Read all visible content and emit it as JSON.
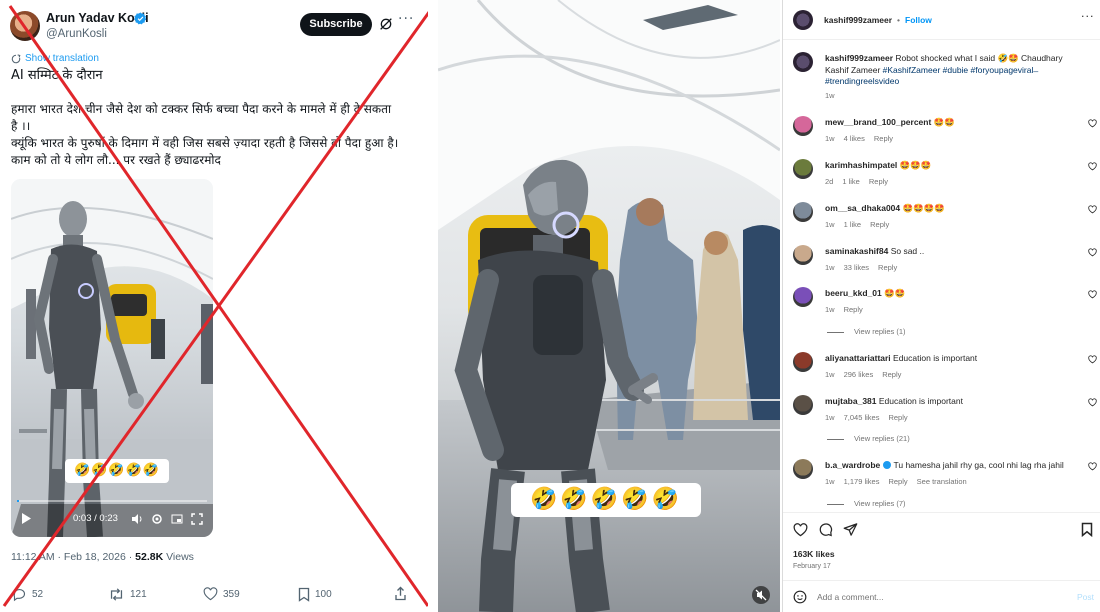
{
  "twitter": {
    "author_name": "Arun Yadav Kosli",
    "handle": "@ArunKosli",
    "subscribe_label": "Subscribe",
    "show_translation": "Show translation",
    "text_lines": [
      "AI सम्मिट के दौरान",
      "हमारा भारत देश चीन जैसे देश को टक्कर सिर्फ बच्चा पैदा करने के मामले में ही दे सकता",
      "है ।।",
      "क्यूंकि भारत के पुरुषों के दिमाग में वही जिस सबसे ज़्यादा रहती है जिससे वो पैदा हुआ है।",
      "काम को तो ये लोग लौ... पर रखते हैं छ्याढरमोद"
    ],
    "video_emojis": "🤣🤣🤣🤣🤣",
    "video_time": "0:03 / 0:23",
    "video_progress": 0.01,
    "timestamp": "11:12 AM · Feb 18, 2026 · ",
    "views_count": "52.8K",
    "views_label": " Views",
    "replies": "52",
    "reposts": "121",
    "likes": "359",
    "bookmarks": "100",
    "colors": {
      "accent": "#1d9bf0",
      "verified": "#1d9bf0",
      "cross": "#e0262b"
    }
  },
  "center_video": {
    "emojis": "🤣🤣🤣🤣🤣"
  },
  "instagram": {
    "username": "kashif999zameer",
    "follow_label": "Follow",
    "caption_user": "kashif999zameer",
    "caption_text": " Robot shocked what I said 🤣🤩 Chaudhary Kashif Zameer ",
    "caption_tags": "#KashifZameer #dubie #foryoupageviral ̶ #trendingreelsvideo",
    "caption_age": "1w",
    "comments": [
      {
        "user": "mew__brand_100_percent",
        "text": " 🤩🤩",
        "age": "1w",
        "likes": "4 likes",
        "reply": "Reply",
        "avatar": "#d5679a"
      },
      {
        "user": "karimhashimpatel",
        "text": " 🤩🤩🤩",
        "age": "2d",
        "likes": "1 like",
        "reply": "Reply",
        "avatar": "#6b7b3c"
      },
      {
        "user": "om__sa_dhaka004",
        "text": " 🤩🤩🤩🤩",
        "age": "1w",
        "likes": "1 like",
        "reply": "Reply",
        "avatar": "#7e8b9a"
      },
      {
        "user": "saminakashif84",
        "text": " So sad ..",
        "age": "1w",
        "likes": "33 likes",
        "reply": "Reply",
        "avatar": "#c9a98c"
      },
      {
        "user": "beeru_kkd_01",
        "text": " 🤩🤩",
        "age": "1w",
        "likes": "",
        "reply": "Reply",
        "avatar": "#7a4fb8"
      },
      {
        "user": "aliyanattariattari",
        "text": " Education is important",
        "age": "1w",
        "likes": "296 likes",
        "reply": "Reply",
        "avatar": "#8b3a2a"
      },
      {
        "user": "mujtaba_381",
        "text": " Education is important",
        "age": "1w",
        "likes": "7,045 likes",
        "reply": "Reply",
        "avatar": "#5a5046"
      },
      {
        "user": "b.a_wardrobe",
        "text": " Tu hamesha jahil rhy ga, cool nhi lag rha jahil",
        "age": "1w",
        "likes": "1,179 likes",
        "reply": "Reply",
        "translate": "See translation",
        "avatar": "#8c7a5a"
      }
    ],
    "view_replies": [
      "View replies (1)",
      "View replies (21)",
      "View replies (7)"
    ],
    "likes_count": "163K likes",
    "post_date": "February 17",
    "comment_placeholder": "Add a comment...",
    "post_label": "Post",
    "colors": {
      "follow": "#0095f6",
      "tag": "#00376b",
      "post_disabled": "#b2dffc"
    }
  }
}
